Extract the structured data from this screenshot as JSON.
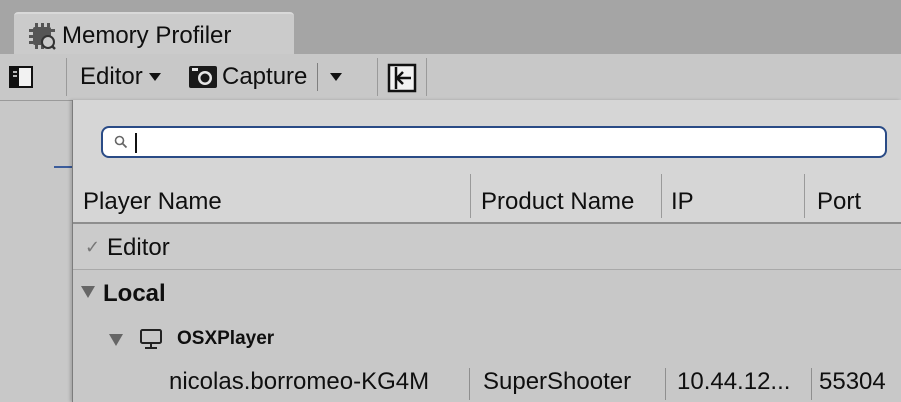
{
  "window": {
    "tab_title": "Memory Profiler",
    "tab_icon": "memory-profiler-icon"
  },
  "toolbar": {
    "target_label": "Editor",
    "capture_label": "Capture",
    "icons": {
      "sidebar": "sidebar-toggle-icon",
      "capture": "camera-icon",
      "import": "import-icon",
      "dropdown": "chevron-down-icon"
    }
  },
  "search": {
    "value": "",
    "placeholder": ""
  },
  "table": {
    "columns": [
      "Player Name",
      "Product Name",
      "IP",
      "Port"
    ]
  },
  "items": {
    "editor": {
      "label": "Editor",
      "checkmark": "✓",
      "selected": true
    },
    "local_group": {
      "label": "Local",
      "expanded": true
    },
    "platform_group": {
      "label": "OSXPlayer",
      "icon": "monitor-icon",
      "expanded": true
    },
    "player": {
      "name": "nicolas.borromeo-KG4M",
      "product": "SuperShooter",
      "ip": "10.44.12...",
      "port": "55304"
    }
  },
  "colors": {
    "search_border": "#2a4b86",
    "tab_strip": "#a5a5a5",
    "panel_bg": "#c8c8c8"
  }
}
